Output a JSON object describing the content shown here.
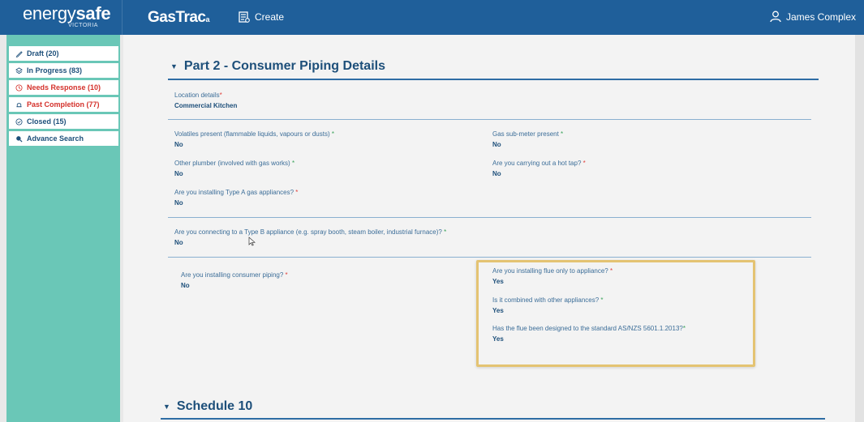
{
  "header": {
    "brand_part1": "energy",
    "brand_part2": "safe",
    "brand_sub": "VICTORIA",
    "app_name": "GasTrac",
    "app_mark": "a",
    "create_label": "Create",
    "user_name": "James Complex",
    "bar_color": "#1f5f9a"
  },
  "sidebar": {
    "color": "#6ac7b7",
    "items": [
      {
        "label": "Draft (20)",
        "icon": "pencil-icon"
      },
      {
        "label": "In Progress (83)",
        "icon": "layers-icon"
      },
      {
        "label": "Needs Response (10)",
        "icon": "clock-icon"
      },
      {
        "label": "Past Completion (77)",
        "icon": "bell-icon"
      },
      {
        "label": "Closed (15)",
        "icon": "check-circle-icon"
      },
      {
        "label": "Advance Search",
        "icon": "search-icon"
      }
    ]
  },
  "part2": {
    "title": "Part 2 - Consumer Piping Details",
    "location": {
      "label": "Location details",
      "value": "Commercial Kitchen"
    },
    "volatiles": {
      "label": "Volatiles present (flammable liquids, vapours or dusts)",
      "value": "No"
    },
    "submeter": {
      "label": "Gas sub-meter present",
      "value": "No"
    },
    "other_plumber": {
      "label": "Other plumber (involved with gas works)",
      "value": "No"
    },
    "hot_tap": {
      "label": "Are you carrying out a hot tap?",
      "value": "No"
    },
    "type_a": {
      "label": "Are you installing Type A gas appliances?",
      "value": "No"
    },
    "type_b": {
      "label": "Are you connecting to a Type B appliance (e.g. spray booth, steam boiler, industrial furnace)?",
      "value": "No"
    },
    "consumer_piping": {
      "label": "Are you installing consumer piping?",
      "value": "No"
    },
    "flue_only": {
      "label": "Are you installing flue only to appliance?",
      "value": "Yes"
    },
    "combined": {
      "label": "Is it combined with other appliances?",
      "value": "Yes"
    },
    "flue_standard": {
      "label": "Has the flue been designed to the standard AS/NZS 5601.1.2013?",
      "value": "Yes"
    }
  },
  "schedule": {
    "title": "Schedule 10"
  },
  "marks": {
    "required": "*"
  },
  "colors": {
    "required_red": "#e0403b",
    "required_green": "#3aa35a",
    "highlight": "#e4c372"
  }
}
